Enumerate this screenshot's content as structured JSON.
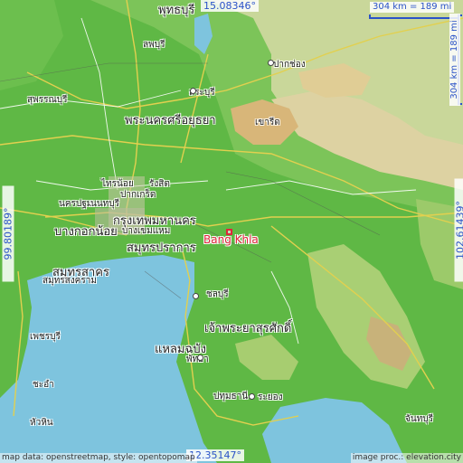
{
  "map": {
    "city_name": "Bang Khla",
    "coords": {
      "top": "15.08346°",
      "bottom": "12.35147°",
      "left": "99.80189°",
      "right": "102.61439°"
    },
    "scale": {
      "horizontal": "304 km = 189 mi",
      "vertical": "304 km = 189 mi"
    },
    "attribution": {
      "left": "map data: openstreetmap, style: opentopomap",
      "right": "image proc.: elevation.city"
    },
    "places": [
      {
        "key": "p1",
        "label": "พุทธบุรี"
      },
      {
        "key": "p2",
        "label": "สุพรรณบุรี"
      },
      {
        "key": "p3",
        "label": "สระบุรี"
      },
      {
        "key": "p4",
        "label": "พระนครศรีอยุธยา"
      },
      {
        "key": "p5",
        "label": "ปทุมธานี"
      },
      {
        "key": "p6",
        "label": "นครปฐม"
      },
      {
        "key": "p7",
        "label": "นนทบุรี"
      },
      {
        "key": "p8",
        "label": "กรุงเทพมหานคร"
      },
      {
        "key": "p9",
        "label": "สมุทรปราการ"
      },
      {
        "key": "p10",
        "label": "สมุทรสาคร"
      },
      {
        "key": "p11",
        "label": "สมุทรสงคราม"
      },
      {
        "key": "p12",
        "label": "ชลบุรี"
      },
      {
        "key": "p13",
        "label": "เจ้าพระยาสุรศักดิ์"
      },
      {
        "key": "p14",
        "label": "แหลมฉบัง"
      },
      {
        "key": "p15",
        "label": "พัทยา"
      },
      {
        "key": "p16",
        "label": "ระยอง"
      },
      {
        "key": "p17",
        "label": "ลพบุรี"
      },
      {
        "key": "p18",
        "label": "ปากช่อง"
      },
      {
        "key": "p19",
        "label": "จันทบุรี"
      },
      {
        "key": "p20",
        "label": "เพชรบุรี"
      },
      {
        "key": "p21",
        "label": "หัวหิน"
      },
      {
        "key": "p22",
        "label": "ชะอำ"
      },
      {
        "key": "p23",
        "label": "รังสิต"
      },
      {
        "key": "p24",
        "label": "ปากเกร็ด"
      },
      {
        "key": "p25",
        "label": "บางกอกน้อย"
      },
      {
        "key": "p26",
        "label": "บางเขมแหม"
      },
      {
        "key": "p27",
        "label": "ไทรน้อย"
      },
      {
        "key": "p28",
        "label": "เขารีด"
      }
    ]
  }
}
